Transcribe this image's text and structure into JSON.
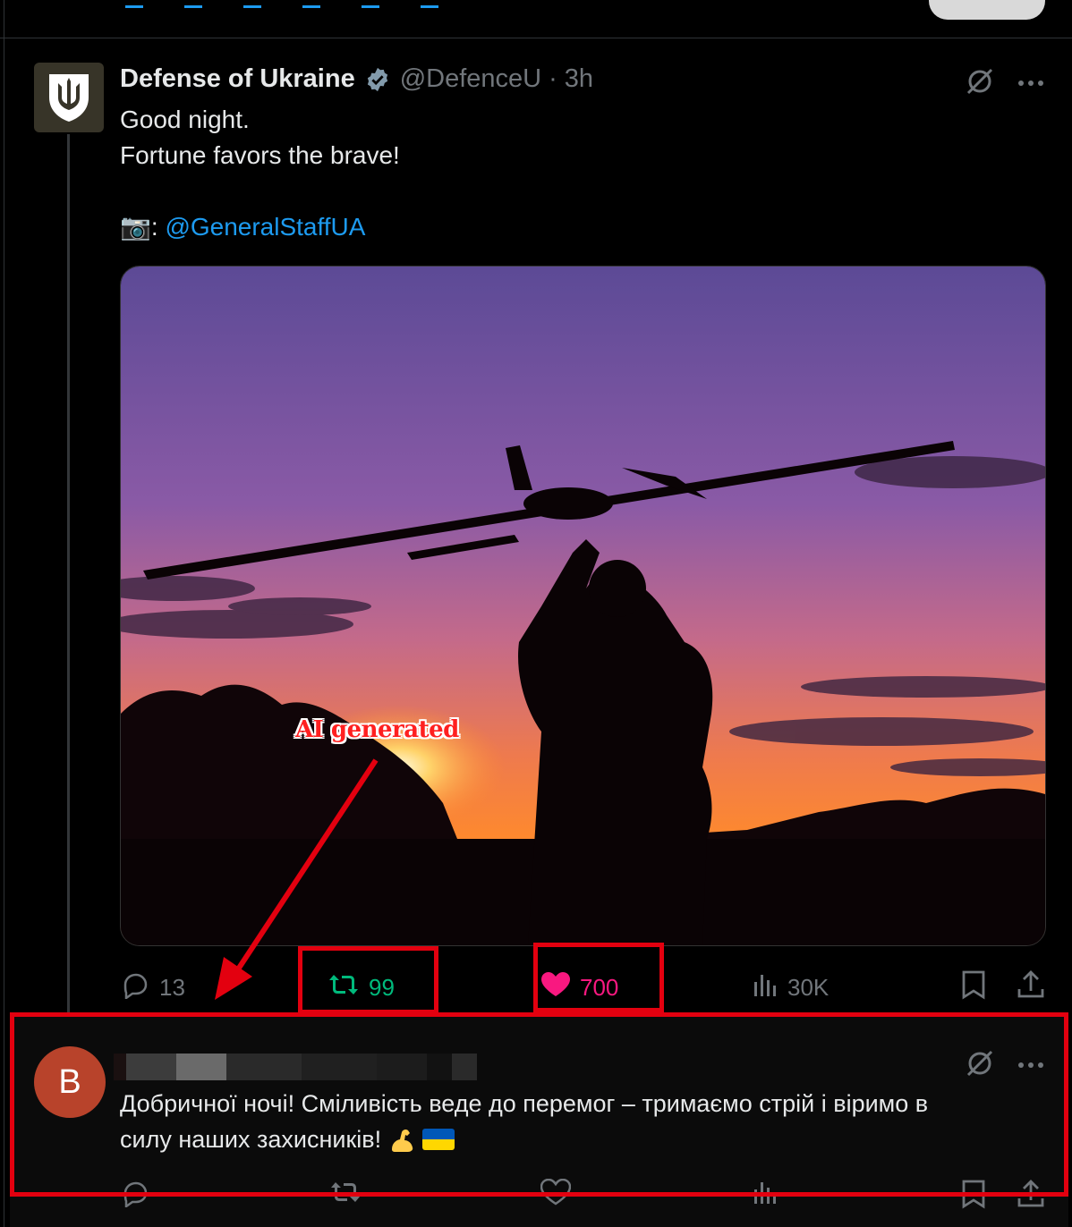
{
  "tweet": {
    "author_name": "Defense of Ukraine",
    "handle": "@DefenceU",
    "separator": "·",
    "time": "3h",
    "text_line1": "Good night.",
    "text_line2": "Fortune favors the brave!",
    "camera_emoji": "📷",
    "credit_colon": ":",
    "credit_mention": "@GeneralStaffUA",
    "annotation_label": "AI generated",
    "stats": {
      "replies": "13",
      "reposts": "99",
      "likes": "700",
      "views": "30K"
    }
  },
  "reply": {
    "avatar_letter": "B",
    "text_line1": "Добричної ночі! Сміливість веде до перемог – тримаємо стрій і віримо в",
    "text_line2": "силу наших захисників!",
    "arm_emoji": "💪",
    "flag_colors": [
      "#0057b7",
      "#ffd700"
    ]
  },
  "colors": {
    "background": "#000000",
    "text": "#e7e9ea",
    "muted": "#71767b",
    "link": "#1d9bf0",
    "repost_green": "#00ba7c",
    "like_pink": "#f91880",
    "annotation_red": "#e3000f"
  },
  "icons": [
    "verified-badge-icon",
    "grok-icon",
    "more-icon",
    "reply-icon",
    "repost-icon",
    "like-icon",
    "views-icon",
    "bookmark-icon",
    "share-icon"
  ]
}
